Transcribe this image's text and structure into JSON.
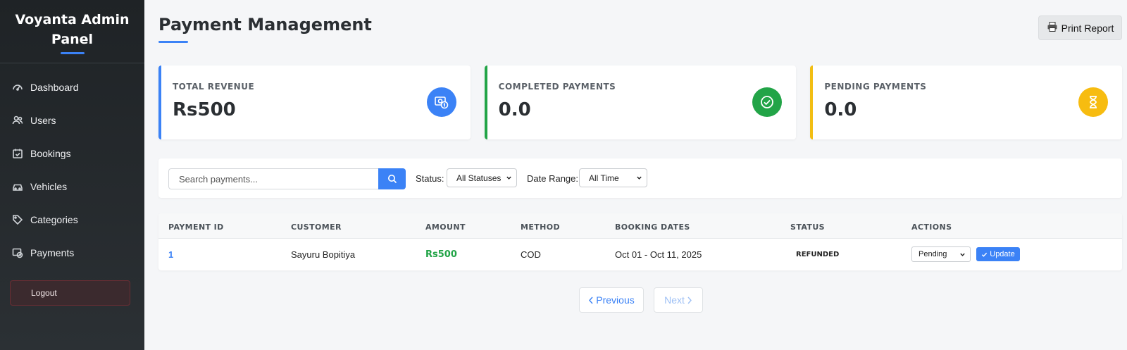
{
  "sidebar": {
    "brand_line1": "Voyanta Admin",
    "brand_line2": "Panel",
    "items": [
      {
        "label": "Dashboard",
        "icon": "gauge-icon"
      },
      {
        "label": "Users",
        "icon": "users-icon"
      },
      {
        "label": "Bookings",
        "icon": "calendar-check-icon"
      },
      {
        "label": "Vehicles",
        "icon": "car-icon"
      },
      {
        "label": "Categories",
        "icon": "tags-icon"
      },
      {
        "label": "Payments",
        "icon": "payment-icon"
      }
    ],
    "logout_label": "Logout"
  },
  "header": {
    "title": "Payment Management",
    "print_label": "Print Report"
  },
  "cards": [
    {
      "label": "TOTAL REVENUE",
      "value": "Rs500",
      "color": "#3b82f6",
      "icon": "money-icon"
    },
    {
      "label": "COMPLETED PAYMENTS",
      "value": "0.0",
      "color": "#22a447",
      "icon": "check-circle-icon"
    },
    {
      "label": "PENDING PAYMENTS",
      "value": "0.0",
      "color": "#f7bc10",
      "icon": "hourglass-icon"
    }
  ],
  "filters": {
    "search_placeholder": "Search payments...",
    "status_label": "Status:",
    "status_value": "All Statuses",
    "date_label": "Date Range:",
    "date_value": "All Time"
  },
  "table": {
    "headers": [
      "PAYMENT ID",
      "CUSTOMER",
      "AMOUNT",
      "METHOD",
      "BOOKING DATES",
      "STATUS",
      "ACTIONS"
    ],
    "rows": [
      {
        "id": "1",
        "customer": "Sayuru Bopitiya",
        "amount": "Rs500",
        "method": "COD",
        "dates": "Oct 01 - Oct 11, 2025",
        "status": "REFUNDED",
        "action_select": "Pending",
        "action_button": "Update"
      }
    ]
  },
  "pagination": {
    "prev_label": "Previous",
    "next_label": "Next"
  }
}
